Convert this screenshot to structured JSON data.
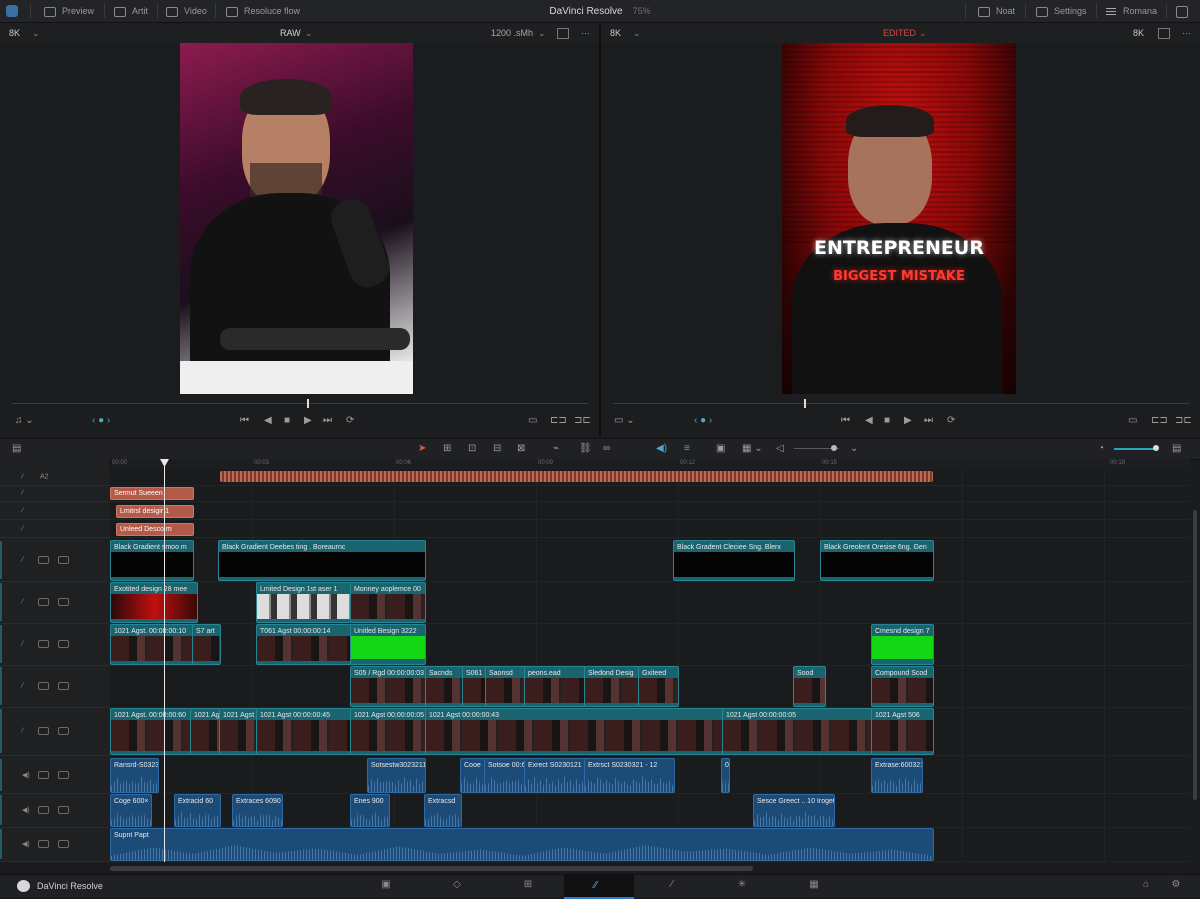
{
  "app": {
    "title": "DaVinci Resolve",
    "zoom": "75%",
    "footer_title": "DaVinci Resolve"
  },
  "menu": {
    "left": [
      "Preview",
      "Artit",
      "Video",
      "Resoluce flow"
    ],
    "right": [
      "Noat",
      "Settings",
      "Romana"
    ]
  },
  "source_viewer": {
    "resolution": "8K",
    "mode": "RAW",
    "bitrate": "1200 .sMh"
  },
  "program_viewer": {
    "resolution": "8K",
    "mode": "EDITED",
    "resolution_right": "8K"
  },
  "overlay": {
    "line1": "ENTREPRENEUR",
    "line2": "BIGGEST MISTAKE"
  },
  "ruler": {
    "ticks": [
      "00:00",
      "00:03",
      "00:06",
      "00:09",
      "00:12",
      "00:15",
      "00:18"
    ]
  },
  "tracks": {
    "text_rows": [
      {
        "label": "A2",
        "clips": [
          {
            "name": "",
            "start": 110,
            "end": 823
          }
        ]
      },
      {
        "label": "",
        "clips": [
          {
            "name": "Sermut Sueeen",
            "start": 0,
            "end": 82
          }
        ]
      },
      {
        "label": "",
        "clips": [
          {
            "name": "Lmitrsl desigir 1",
            "start": 6,
            "end": 82
          }
        ]
      },
      {
        "label": "",
        "clips": [
          {
            "name": "Unleed Desco m",
            "start": 6,
            "end": 82
          }
        ]
      }
    ],
    "video_rows": [
      {
        "clips": [
          {
            "name": "Black Gradient smoo m",
            "start": 0,
            "end": 82,
            "fill": "black"
          },
          {
            "name": "Black Gradient Deebes ting . Boreaurnc",
            "start": 108,
            "end": 314,
            "fill": "black"
          },
          {
            "name": "Black Gradent Cleciee Sng. Blerx",
            "start": 563,
            "end": 683,
            "fill": "black"
          },
          {
            "name": "Black Greolent Oresise 6ng. Gen",
            "start": 710,
            "end": 822,
            "fill": "black"
          }
        ]
      },
      {
        "clips": [
          {
            "name": "Exotited design 28 mee",
            "start": 0,
            "end": 86,
            "fill": "red"
          },
          {
            "name": "Lmited Design 1st aser 1",
            "start": 146,
            "end": 240,
            "fill": "light"
          },
          {
            "name": "Monney aoplemce 00",
            "start": 240,
            "end": 314,
            "fill": "thumb"
          }
        ]
      },
      {
        "clips": [
          {
            "name": "1021 Agst. 00:00:00:10",
            "start": 0,
            "end": 82,
            "fill": "thumb"
          },
          {
            "name": "S7 art",
            "start": 82,
            "end": 109,
            "fill": "thumb"
          },
          {
            "name": "T061 Agst 00:00:00:14",
            "start": 146,
            "end": 240,
            "fill": "thumb"
          },
          {
            "name": "Unitled Besign 3222",
            "start": 240,
            "end": 314,
            "fill": "green"
          },
          {
            "name": "Cmesnd design 7",
            "start": 761,
            "end": 822,
            "fill": "green"
          }
        ]
      },
      {
        "clips": [
          {
            "name": "S05 / Rgd 00:00:00:03",
            "start": 240,
            "end": 315,
            "fill": "thumb"
          },
          {
            "name": "Sacnds",
            "start": 315,
            "end": 352,
            "fill": "thumb"
          },
          {
            "name": "S061",
            "start": 352,
            "end": 375,
            "fill": "thumb"
          },
          {
            "name": "Saonsd",
            "start": 375,
            "end": 414,
            "fill": "thumb"
          },
          {
            "name": "peons.ead",
            "start": 414,
            "end": 474,
            "fill": "thumb"
          },
          {
            "name": "Sledond Desig",
            "start": 474,
            "end": 528,
            "fill": "thumb"
          },
          {
            "name": "Gxiteed",
            "start": 528,
            "end": 567,
            "fill": "thumb"
          },
          {
            "name": "Sood",
            "start": 683,
            "end": 714,
            "fill": "thumb"
          },
          {
            "name": "Compound Scod",
            "start": 761,
            "end": 822,
            "fill": "thumb"
          }
        ]
      },
      {
        "clips": [
          {
            "name": "1021 Agst. 00:00:00:60",
            "start": 0,
            "end": 80,
            "fill": "thumb"
          },
          {
            "name": "1021 Agst",
            "start": 80,
            "end": 109,
            "fill": "thumb"
          },
          {
            "name": "1021 Agst",
            "start": 109,
            "end": 146,
            "fill": "thumb"
          },
          {
            "name": "1021 Agst 00:00:00:45",
            "start": 146,
            "end": 240,
            "fill": "thumb"
          },
          {
            "name": "1021 Agst 00:00:00:05",
            "start": 240,
            "end": 315,
            "fill": "thumb"
          },
          {
            "name": "1021 Agst 00:00:00:43",
            "start": 315,
            "end": 612,
            "fill": "thumb"
          },
          {
            "name": "1021 Agst 00:00:00:05",
            "start": 612,
            "end": 761,
            "fill": "thumb"
          },
          {
            "name": "1021 Agst 506",
            "start": 761,
            "end": 822,
            "fill": "thumb"
          }
        ]
      }
    ],
    "audio_rows": [
      {
        "clips": [
          {
            "name": "Ransrd-S0323",
            "start": 0,
            "end": 47
          },
          {
            "name": "Sotsestw3023211",
            "start": 257,
            "end": 314
          },
          {
            "name": "Cooe",
            "start": 350,
            "end": 374
          },
          {
            "name": "Sotsoe 00:63",
            "start": 374,
            "end": 414
          },
          {
            "name": "Exrect S0230121",
            "start": 414,
            "end": 474
          },
          {
            "name": "Extrsct S0230321 - 12",
            "start": 474,
            "end": 563
          },
          {
            "name": "0",
            "start": 611,
            "end": 618
          },
          {
            "name": "Extrase:600321",
            "start": 761,
            "end": 811
          }
        ]
      },
      {
        "clips": [
          {
            "name": "Coge 600×",
            "start": 0,
            "end": 40
          },
          {
            "name": "Extracid 60",
            "start": 64,
            "end": 109
          },
          {
            "name": "Extraces 6090",
            "start": 122,
            "end": 171
          },
          {
            "name": "Enes 900",
            "start": 240,
            "end": 278
          },
          {
            "name": "Extracsd",
            "start": 314,
            "end": 350
          },
          {
            "name": "Sesce Greect .. 10 Iroget",
            "start": 643,
            "end": 723
          }
        ]
      },
      {
        "clips": [
          {
            "name": "Supnt Papt",
            "start": 0,
            "end": 822
          }
        ]
      }
    ]
  },
  "colors": {
    "accent": "#e25a3a",
    "edited": "#e2463a",
    "video_clip": "#1a6470",
    "audio_clip": "#1d4b78",
    "text_clip": "#b45a48"
  },
  "icons": [
    "resolve-logo-icon",
    "play-icon",
    "stop-icon",
    "loop-icon",
    "blade-icon",
    "settings-icon"
  ]
}
